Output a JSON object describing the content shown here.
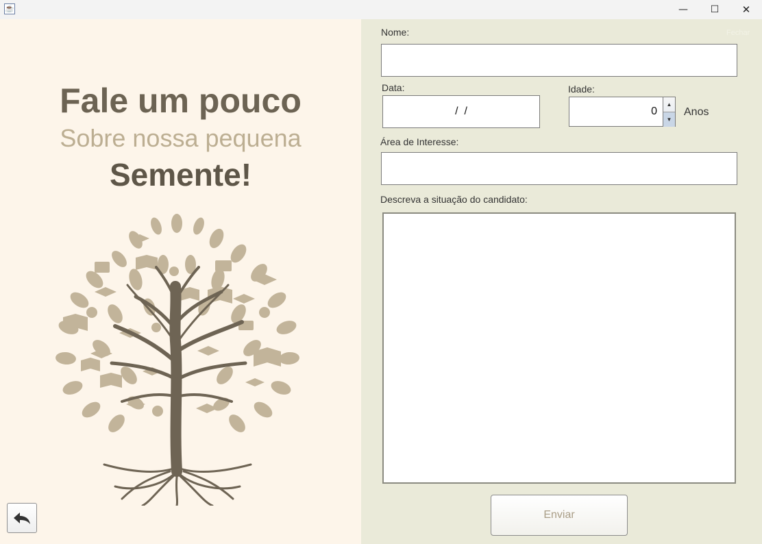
{
  "window": {
    "icon": "java-cup-icon",
    "controls": {
      "minimize": "—",
      "maximize": "☐",
      "close": "✕"
    }
  },
  "left_panel": {
    "headline": "Fale um pouco",
    "subheadline": "Sobre nossa pequena",
    "emphasis": "Semente!",
    "illustration": "tree-with-books-icon",
    "back_button_icon": "back-arrow-icon"
  },
  "form": {
    "nome_label": "Nome:",
    "nome_value": "",
    "data_label": "Data:",
    "data_value": " /  / ",
    "idade_label": "Idade:",
    "idade_value": "0",
    "anos_label": "Anos",
    "area_label": "Área de Interesse:",
    "area_value": "",
    "descricao_label": "Descreva a situação do candidato:",
    "descricao_value": "",
    "submit_label": "Enviar",
    "faint_text": "Fechar"
  },
  "colors": {
    "left_bg": "#fdf5ea",
    "right_bg": "#eaead9",
    "title_dark": "#6c6353",
    "subtitle_light": "#bcae92",
    "tree_brown": "#6e6454",
    "leaf_beige": "#c2b49a"
  }
}
